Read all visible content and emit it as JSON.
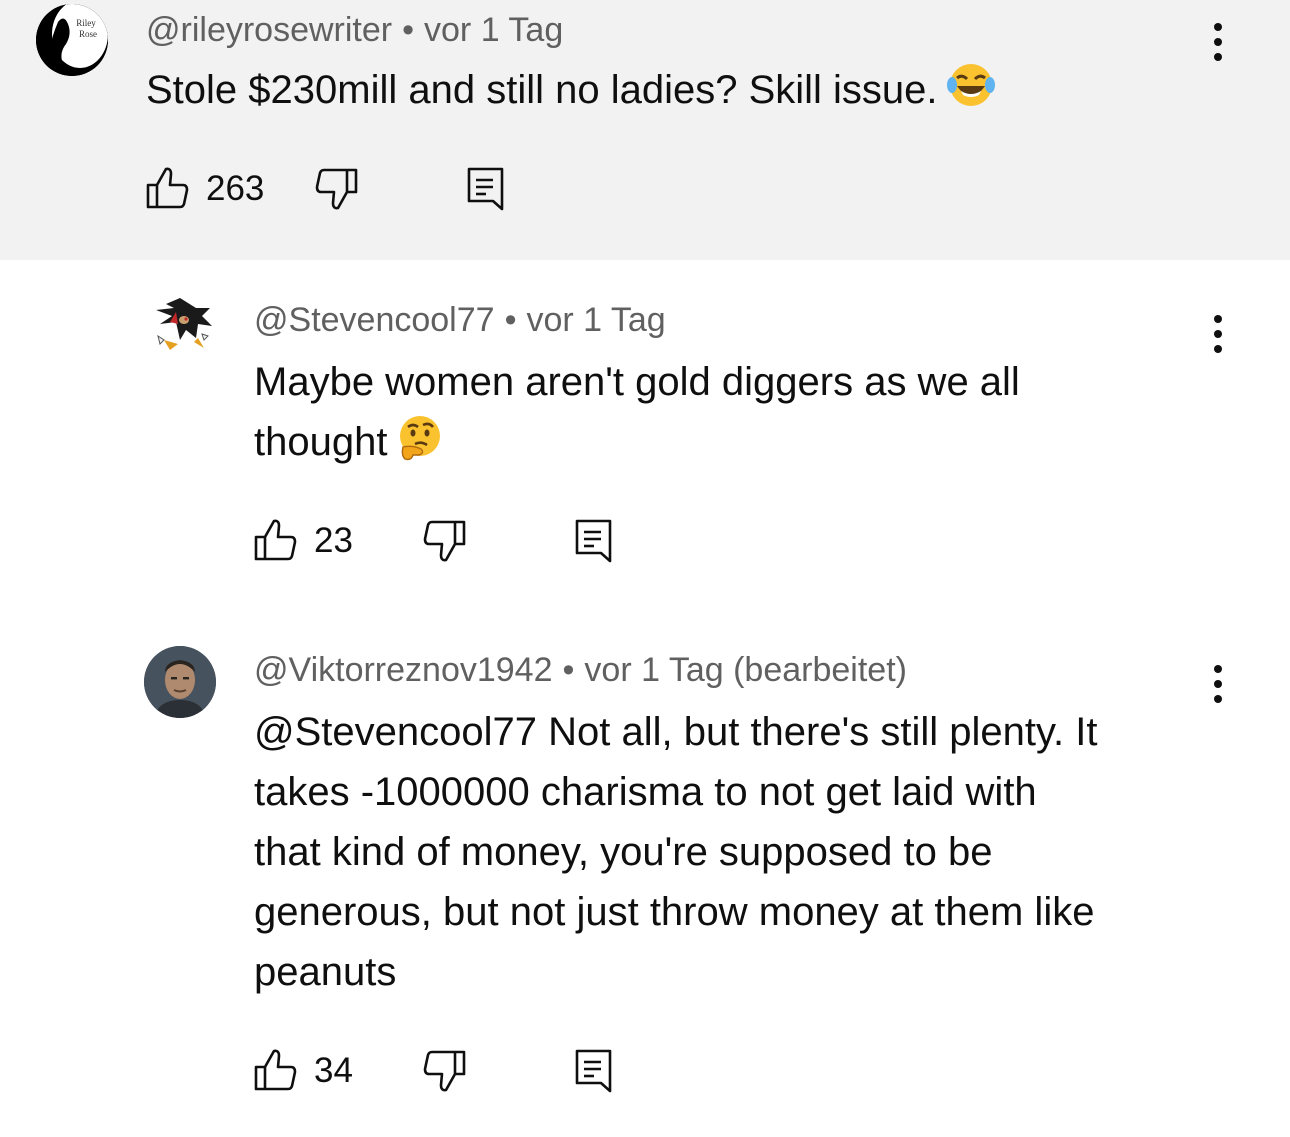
{
  "comments": [
    {
      "author": "@rileyrosewriter",
      "separator": "•",
      "time": "vor 1 Tag",
      "text": "Stole $230mill and still no ladies? Skill issue.",
      "emoji": "tears-of-joy-emoji",
      "likes": "263",
      "avatar_text_1": "Riley",
      "avatar_text_2": "Rose"
    },
    {
      "author": "@Stevencool77",
      "separator": "•",
      "time": "vor 1 Tag",
      "text_line1": "Maybe women aren't gold diggers as we all",
      "text_line2": "thought",
      "emoji": "thinking-face-emoji",
      "likes": "23"
    },
    {
      "author": "@Viktorreznov1942",
      "separator": "•",
      "time": "vor 1 Tag (bearbeitet)",
      "lines": [
        "@Stevencool77 Not all, but there's still plenty. It",
        "takes -1000000 charisma to not get laid with",
        "that kind of money, you're supposed to be",
        "generous, but not just throw money at them like",
        "peanuts"
      ],
      "likes": "34"
    }
  ],
  "icons": {
    "like": "thumbs-up-icon",
    "dislike": "thumbs-down-icon",
    "reply": "reply-comment-icon",
    "more": "more-vertical-icon"
  },
  "colors": {
    "highlight_bg": "#f2f2f2",
    "meta_text": "#606060",
    "body_text": "#0f0f0f"
  }
}
